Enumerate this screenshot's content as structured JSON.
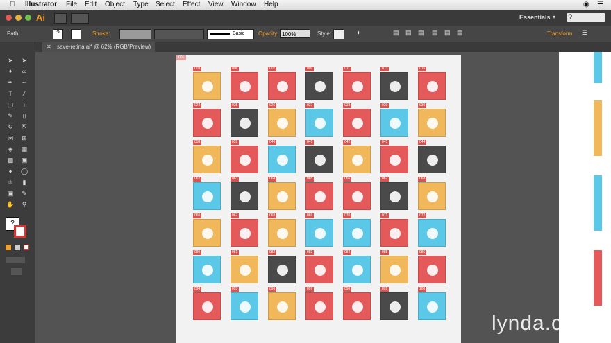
{
  "menubar": {
    "app_name": "Illustrator",
    "items": [
      "File",
      "Edit",
      "Object",
      "Type",
      "Select",
      "Effect",
      "View",
      "Window",
      "Help"
    ]
  },
  "appbar": {
    "app_logo": "Ai",
    "workspace": "Essentials",
    "search_icon": "search-icon"
  },
  "control": {
    "selection_label": "Path",
    "stroke_label": "Stroke:",
    "brush_label": "Basic",
    "opacity_label": "Opacity:",
    "opacity_value": "100%",
    "style_label": "Style:",
    "transform_label": "Transform"
  },
  "document": {
    "tab_title": "save-retina.ai* @ 62% (RGB/Preview)"
  },
  "artboard": {
    "label": "001",
    "rows": [
      [
        {
          "id": "003",
          "color": "#f0b85a",
          "icon": "search-icon"
        },
        {
          "id": "006",
          "color": "#e45a5a",
          "icon": "shop-icon"
        },
        {
          "id": "007",
          "color": "#e45a5a",
          "icon": "gear-icon"
        },
        {
          "id": "009",
          "color": "#4a4a4a",
          "icon": "wrench-icon"
        },
        {
          "id": "011",
          "color": "#e45a5a",
          "icon": "grid-icon"
        },
        {
          "id": "013",
          "color": "#4a4a4a",
          "icon": "lock-icon"
        },
        {
          "id": "016",
          "color": "#e45a5a",
          "icon": "binoculars-icon"
        }
      ],
      [
        {
          "id": "024",
          "color": "#e45a5a",
          "icon": "eye-icon"
        },
        {
          "id": "025",
          "color": "#4a4a4a",
          "icon": "bell-icon"
        },
        {
          "id": "026",
          "color": "#f0b85a",
          "icon": "speaker-icon"
        },
        {
          "id": "027",
          "color": "#5bc8e8",
          "icon": "mute-icon"
        },
        {
          "id": "028",
          "color": "#e45a5a",
          "icon": "mouse-icon"
        },
        {
          "id": "029",
          "color": "#5bc8e8",
          "icon": "cloud-icon"
        },
        {
          "id": "030",
          "color": "#f0b85a",
          "icon": "bulb-icon"
        }
      ],
      [
        {
          "id": "038",
          "color": "#f0b85a",
          "icon": "headset-icon"
        },
        {
          "id": "039",
          "color": "#e45a5a",
          "icon": "monitor-icon"
        },
        {
          "id": "040",
          "color": "#5bc8e8",
          "icon": "phone-icon"
        },
        {
          "id": "041",
          "color": "#4a4a4a",
          "icon": "camera-icon"
        },
        {
          "id": "042",
          "color": "#f0b85a",
          "icon": "video-icon"
        },
        {
          "id": "043",
          "color": "#e45a5a",
          "icon": "call-icon"
        },
        {
          "id": "044",
          "color": "#4a4a4a",
          "icon": "call-end-icon"
        }
      ],
      [
        {
          "id": "062",
          "color": "#5bc8e8",
          "icon": "home-icon"
        },
        {
          "id": "063",
          "color": "#4a4a4a",
          "icon": "wifi-icon"
        },
        {
          "id": "064",
          "color": "#f0b85a",
          "icon": "globe-icon"
        },
        {
          "id": "065",
          "color": "#e45a5a",
          "icon": "chat-icon"
        },
        {
          "id": "066",
          "color": "#e45a5a",
          "icon": "flag-icon"
        },
        {
          "id": "067",
          "color": "#4a4a4a",
          "icon": "folder-icon"
        },
        {
          "id": "068",
          "color": "#f0b85a",
          "icon": "mail-icon"
        }
      ],
      [
        {
          "id": "066",
          "color": "#f0b85a",
          "icon": "book-icon"
        },
        {
          "id": "067",
          "color": "#e45a5a",
          "icon": "document-icon"
        },
        {
          "id": "068",
          "color": "#f0b85a",
          "icon": "notes-icon"
        },
        {
          "id": "069",
          "color": "#5bc8e8",
          "icon": "star-icon"
        },
        {
          "id": "070",
          "color": "#5bc8e8",
          "icon": "user-card-icon"
        },
        {
          "id": "071",
          "color": "#e45a5a",
          "icon": "mouse2-icon"
        },
        {
          "id": "072",
          "color": "#5bc8e8",
          "icon": "heart-icon"
        }
      ],
      [
        {
          "id": "080",
          "color": "#5bc8e8",
          "icon": "user-icon"
        },
        {
          "id": "081",
          "color": "#f0b85a",
          "icon": "briefcase-icon"
        },
        {
          "id": "082",
          "color": "#4a4a4a",
          "icon": "cup-icon"
        },
        {
          "id": "083",
          "color": "#e45a5a",
          "icon": "send-icon"
        },
        {
          "id": "084",
          "color": "#5bc8e8",
          "icon": "pin-icon"
        },
        {
          "id": "085",
          "color": "#f0b85a",
          "icon": "cursor-icon"
        },
        {
          "id": "086",
          "color": "#e45a5a",
          "icon": "flag2-icon"
        }
      ],
      [
        {
          "id": "094",
          "color": "#e45a5a",
          "icon": "pie-icon"
        },
        {
          "id": "095",
          "color": "#5bc8e8",
          "icon": "chart-icon"
        },
        {
          "id": "096",
          "color": "#f0b85a",
          "icon": "clock-icon"
        },
        {
          "id": "097",
          "color": "#e45a5a",
          "icon": "clock2-icon"
        },
        {
          "id": "098",
          "color": "#e45a5a",
          "icon": "pencil-icon"
        },
        {
          "id": "099",
          "color": "#4a4a4a",
          "icon": "pushpin-icon"
        },
        {
          "id": "100",
          "color": "#5bc8e8",
          "icon": "attachment-icon"
        }
      ]
    ]
  },
  "watermark": "lynda.com"
}
